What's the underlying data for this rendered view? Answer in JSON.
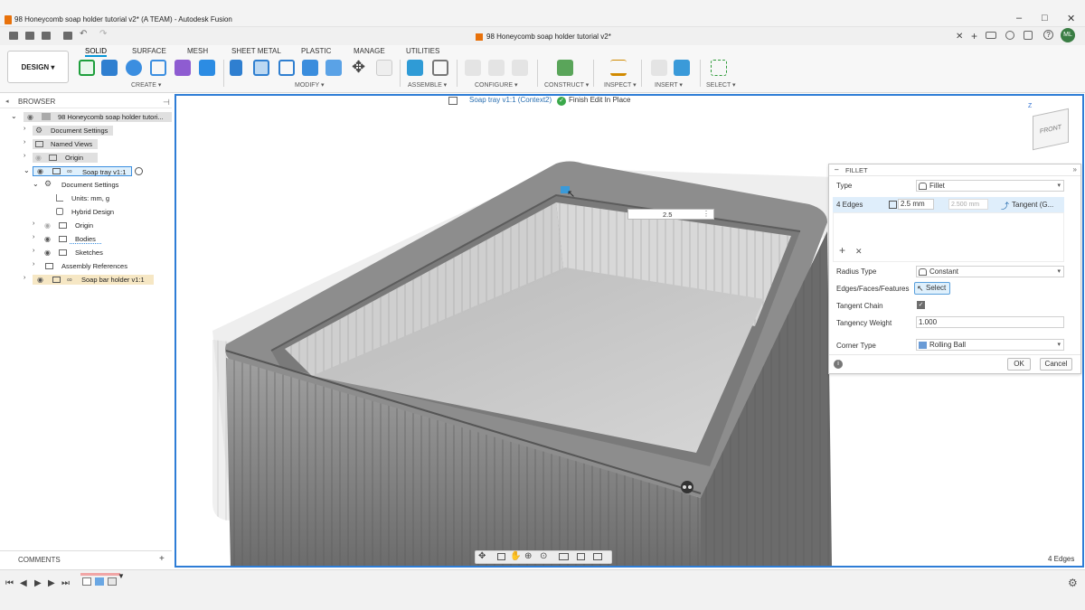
{
  "window": {
    "title": "98 Honeycomb soap holder tutorial v2* (A TEAM) - Autodesk Fusion",
    "controls": [
      "–",
      "□",
      "✕"
    ]
  },
  "doc_tab": {
    "label": "98 Honeycomb soap holder tutorial v2*"
  },
  "user": {
    "initials": "ML",
    "accent": "#3a7d44"
  },
  "workspace": {
    "label": "DESIGN ▾"
  },
  "ribbon": {
    "tabs": [
      "SOLID",
      "SURFACE",
      "MESH",
      "SHEET METAL",
      "PLASTIC",
      "MANAGE",
      "UTILITIES"
    ],
    "active_tab": "SOLID",
    "groups": [
      "CREATE ▾",
      "MODIFY ▾",
      "ASSEMBLE ▾",
      "CONFIGURE ▾",
      "CONSTRUCT ▾",
      "INSPECT ▾",
      "INSERT ▾",
      "SELECT ▾"
    ]
  },
  "browser": {
    "title": "BROWSER",
    "root": "98 Honeycomb soap holder tutori...",
    "nodes": [
      "Document Settings",
      "Named Views",
      "Origin",
      "Soap tray v1:1",
      "Document Settings",
      "Units: mm, g",
      "Hybrid Design",
      "Origin",
      "Bodies",
      "Sketches",
      "Assembly References",
      "Soap bar holder v1:1"
    ]
  },
  "context": {
    "component": "Soap tray v1:1 (Context2)",
    "finish": "Finish Edit In Place"
  },
  "viewcube": {
    "face": "FRONT",
    "axis": "Z"
  },
  "dimension_input": {
    "value": "2.5"
  },
  "fillet": {
    "title": "FILLET",
    "type_label": "Type",
    "type_value": "Fillet",
    "edges_label": "4 Edges",
    "radius_value": "2.5 mm",
    "radius_end": "2.500 mm",
    "tangent_value": "Tangent (G...",
    "add_icon": "+",
    "remove_icon": "✕",
    "radius_type_label": "Radius Type",
    "radius_type_value": "Constant",
    "efs_label": "Edges/Faces/Features",
    "select_btn": "Select",
    "tangent_chain_label": "Tangent Chain",
    "tangent_chain_checked": true,
    "tangency_weight_label": "Tangency Weight",
    "tangency_weight_value": "1.000",
    "corner_type_label": "Corner Type",
    "corner_type_value": "Rolling Ball",
    "ok": "OK",
    "cancel": "Cancel"
  },
  "comments": {
    "label": "COMMENTS",
    "add": "+"
  },
  "status": {
    "selection": "4 Edges"
  }
}
